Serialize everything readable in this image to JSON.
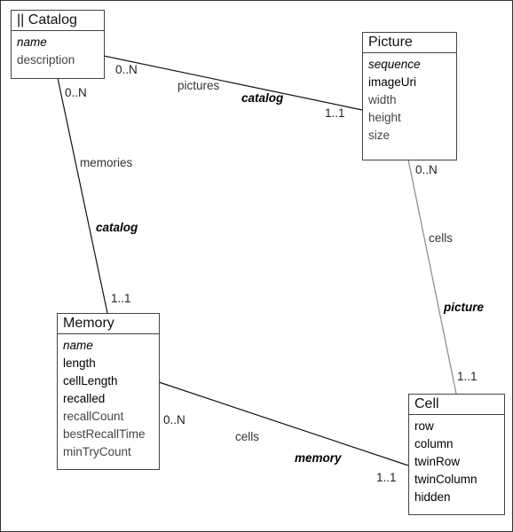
{
  "classes": {
    "catalog": {
      "title": "|| Catalog",
      "attributes": [
        {
          "text": "name",
          "style": "italic"
        },
        {
          "text": "description",
          "style": "normal"
        }
      ]
    },
    "picture": {
      "title": "Picture",
      "attributes": [
        {
          "text": "sequence",
          "style": "italic"
        },
        {
          "text": "imageUri",
          "style": "key"
        },
        {
          "text": "width",
          "style": "normal"
        },
        {
          "text": "height",
          "style": "normal"
        },
        {
          "text": "size",
          "style": "normal"
        }
      ]
    },
    "memory": {
      "title": "Memory",
      "attributes": [
        {
          "text": "name",
          "style": "italic"
        },
        {
          "text": "length",
          "style": "key"
        },
        {
          "text": "cellLength",
          "style": "key"
        },
        {
          "text": "recalled",
          "style": "key"
        },
        {
          "text": "recallCount",
          "style": "normal"
        },
        {
          "text": "bestRecallTime",
          "style": "normal"
        },
        {
          "text": "minTryCount",
          "style": "normal"
        }
      ]
    },
    "cell": {
      "title": "Cell",
      "attributes": [
        {
          "text": "row",
          "style": "key"
        },
        {
          "text": "column",
          "style": "key"
        },
        {
          "text": "twinRow",
          "style": "key"
        },
        {
          "text": "twinColumn",
          "style": "key"
        },
        {
          "text": "hidden",
          "style": "key"
        }
      ]
    }
  },
  "associations": {
    "catalog_picture": {
      "mult_from": "0..N",
      "name": "pictures",
      "role": "catalog",
      "mult_to": "1..1"
    },
    "catalog_memory": {
      "mult_from": "0..N",
      "name": "memories",
      "role": "catalog",
      "mult_to": "1..1"
    },
    "picture_cell": {
      "mult_from": "0..N",
      "name": "cells",
      "role": "picture",
      "mult_to": "1..1"
    },
    "memory_cell": {
      "mult_from": "0..N",
      "name": "cells",
      "role": "memory",
      "mult_to": "1..1"
    }
  }
}
